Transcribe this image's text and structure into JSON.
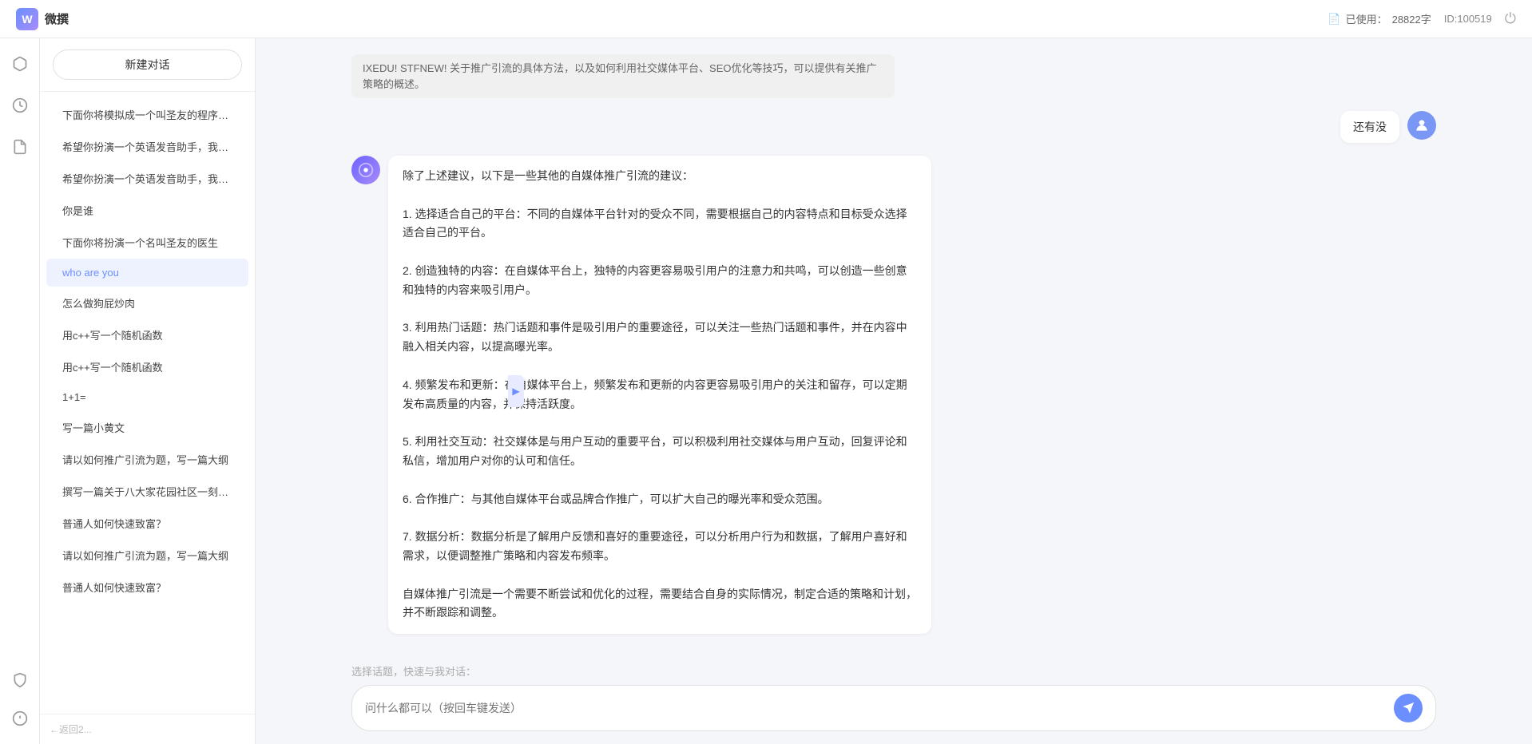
{
  "header": {
    "logo_char": "W",
    "title": "微撰",
    "usage_icon": "📄",
    "usage_label": "已使用：",
    "usage_value": "28822字",
    "id_label": "ID:100519",
    "power_label": "power"
  },
  "sidebar": {
    "new_chat": "新建对话",
    "items": [
      {
        "label": "下面你将模拟成一个叫圣友的程序员，我说...",
        "active": false
      },
      {
        "label": "希望你扮演一个英语发音助手，我提供给你...",
        "active": false
      },
      {
        "label": "希望你扮演一个英语发音助手，我提供给你...",
        "active": false
      },
      {
        "label": "你是谁",
        "active": false
      },
      {
        "label": "下面你将扮演一个名叫圣友的医生",
        "active": false
      },
      {
        "label": "who are you",
        "active": true
      },
      {
        "label": "怎么做狗屁炒肉",
        "active": false
      },
      {
        "label": "用c++写一个随机函数",
        "active": false
      },
      {
        "label": "用c++写一个随机函数",
        "active": false
      },
      {
        "label": "1+1=",
        "active": false
      },
      {
        "label": "写一篇小黄文",
        "active": false
      },
      {
        "label": "请以如何推广引流为题，写一篇大纲",
        "active": false
      },
      {
        "label": "撰写一篇关于八大家花园社区一刻钟便民生...",
        "active": false
      },
      {
        "label": "普通人如何快速致富？",
        "active": false
      },
      {
        "label": "请以如何推广引流为题，写一篇大纲",
        "active": false
      },
      {
        "label": "普通人如何快速致富？",
        "active": false
      }
    ],
    "bottom_text": "←返回2..."
  },
  "iconbar": {
    "icons": [
      {
        "name": "cube-icon",
        "char": "⬡",
        "active": false
      },
      {
        "name": "clock-icon",
        "char": "🕐",
        "active": false
      },
      {
        "name": "document-icon",
        "char": "📄",
        "active": false
      }
    ],
    "bottom_icons": [
      {
        "name": "shield-icon",
        "char": "🛡"
      },
      {
        "name": "info-icon",
        "char": "ℹ"
      }
    ]
  },
  "chat": {
    "messages": [
      {
        "role": "system_partial",
        "text": "IXEDU! STFNEW! 关于推广引流的具体方法，以及如何利用社交媒体平台、SEO优化等技巧，可以提供有关推广策略的概述。"
      },
      {
        "role": "user",
        "text": "还有没"
      },
      {
        "role": "ai",
        "text": "除了上述建议，以下是一些其他的自媒体推广引流的建议：\n\n1. 选择适合自己的平台：不同的自媒体平台针对的受众不同，需要根据自己的内容特点和目标受众选择适合自己的平台。\n\n2. 创造独特的内容：在自媒体平台上，独特的内容更容易吸引用户的注意力和共鸣，可以创造一些创意和独特的内容来吸引用户。\n\n3. 利用热门话题：热门话题和事件是吸引用户的重要途径，可以关注一些热门话题和事件，并在内容中融入相关内容，以提高曝光率。\n\n4. 频繁发布和更新：在自媒体平台上，频繁发布和更新的内容更容易吸引用户的关注和留存，可以定期发布高质量的内容，并保持活跃度。\n\n5. 利用社交互动：社交媒体是与用户互动的重要平台，可以积极利用社交媒体与用户互动，回复评论和私信，增加用户对你的认可和信任。\n\n6. 合作推广：与其他自媒体平台或品牌合作推广，可以扩大自己的曝光率和受众范围。\n\n7. 数据分析：数据分析是了解用户反馈和喜好的重要途径，可以分析用户行为和数据，了解用户喜好和需求，以便调整推广策略和内容发布频率。\n\n自媒体推广引流是一个需要不断尝试和优化的过程，需要结合自身的实际情况，制定合适的策略和计划，并不断跟踪和调整。"
      }
    ],
    "quick_select_label": "选择话题，快速与我对话：",
    "input_placeholder": "问什么都可以（按回车键发送）",
    "send_icon": "➤"
  }
}
